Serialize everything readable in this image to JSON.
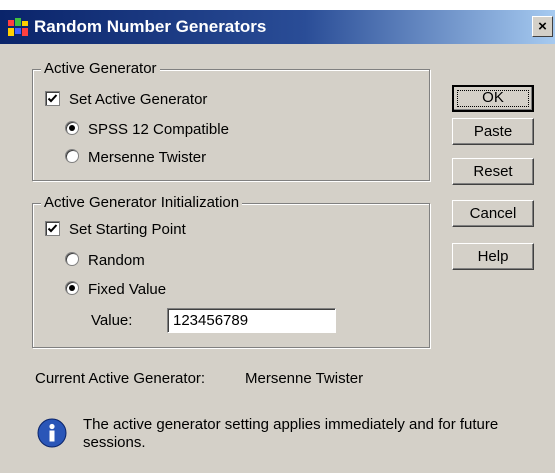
{
  "window": {
    "title": "Random Number Generators",
    "close_label": "×"
  },
  "active_generator": {
    "legend": "Active Generator",
    "set_active_generator": {
      "label": "Set Active Generator",
      "checked": true
    },
    "options": [
      {
        "label": "SPSS 12 Compatible",
        "selected": true
      },
      {
        "label": "Mersenne Twister",
        "selected": false
      }
    ]
  },
  "initialization": {
    "legend": "Active Generator Initialization",
    "set_starting_point": {
      "label": "Set Starting Point",
      "checked": true
    },
    "options": [
      {
        "label": "Random",
        "selected": false
      },
      {
        "label": "Fixed Value",
        "selected": true
      }
    ],
    "value_label": "Value:",
    "value": "123456789"
  },
  "current": {
    "label": "Current Active Generator:",
    "value": "Mersenne Twister"
  },
  "info": {
    "icon": "information-icon",
    "text": "The active generator setting applies immediately and for future sessions."
  },
  "buttons": {
    "ok": "OK",
    "paste": "Paste",
    "reset": "Reset",
    "cancel": "Cancel",
    "help": "Help"
  },
  "colors": {
    "titlebar_start": "#0a246a",
    "titlebar_end": "#a6caf0",
    "face": "#d4d0c8"
  }
}
